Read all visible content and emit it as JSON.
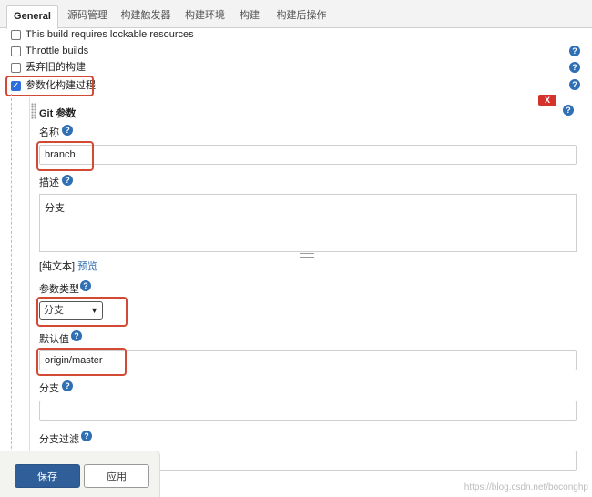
{
  "tabs": [
    "General",
    "源码管理",
    "构建触发器",
    "构建环境",
    "构建",
    "构建后操作"
  ],
  "options": [
    {
      "label": "This build requires lockable resources",
      "checked": false
    },
    {
      "label": "Throttle builds",
      "checked": false
    },
    {
      "label": "丢弃旧的构建",
      "checked": false
    },
    {
      "label": "参数化构建过程",
      "checked": true
    }
  ],
  "param": {
    "title": "Git 参数",
    "delete_label": "X",
    "name_label": "名称",
    "name_value": "branch",
    "desc_label": "描述",
    "desc_value": "分支",
    "plain_text": "[纯文本]",
    "preview": "预览",
    "type_label": "参数类型",
    "type_value": "分支",
    "default_label": "默认值",
    "default_value": "origin/master",
    "branch_label": "分支",
    "branch_value": "",
    "filter_label": "分支过滤"
  },
  "help_glyph": "?",
  "actions": {
    "save": "保存",
    "apply": "应用"
  },
  "watermark": "https://blog.csdn.net/boconghp"
}
